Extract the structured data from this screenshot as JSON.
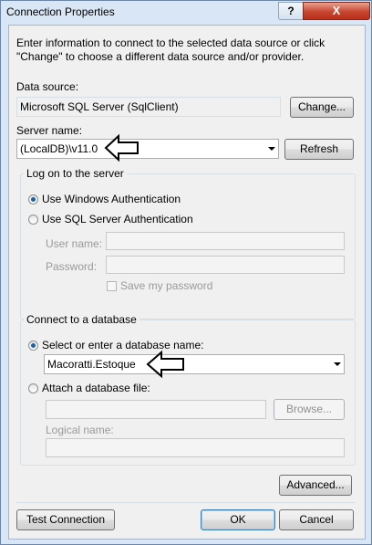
{
  "window": {
    "title": "Connection Properties",
    "help": "?",
    "close": "X"
  },
  "intro": "Enter information to connect to the selected data source or click \"Change\" to choose a different data source and/or provider.",
  "data_source": {
    "label": "Data source:",
    "value": "Microsoft SQL Server (SqlClient)",
    "change_button": "Change..."
  },
  "server": {
    "label": "Server name:",
    "value": "(LocalDB)\\v11.0",
    "refresh_button": "Refresh"
  },
  "logon": {
    "title": "Log on to the server",
    "windows_auth": "Use Windows Authentication",
    "sql_auth": "Use SQL Server Authentication",
    "user_name_label": "User name:",
    "password_label": "Password:",
    "save_password": "Save my password"
  },
  "database": {
    "title": "Connect to a database",
    "select_option": "Select or enter a database name:",
    "database_name": "Macoratti.Estoque",
    "attach_option": "Attach a database file:",
    "browse_button": "Browse...",
    "logical_name_label": "Logical name:"
  },
  "buttons": {
    "advanced": "Advanced...",
    "test": "Test Connection",
    "ok": "OK",
    "cancel": "Cancel"
  },
  "icons": {
    "pointer_arrow": "left-arrow-icon"
  }
}
